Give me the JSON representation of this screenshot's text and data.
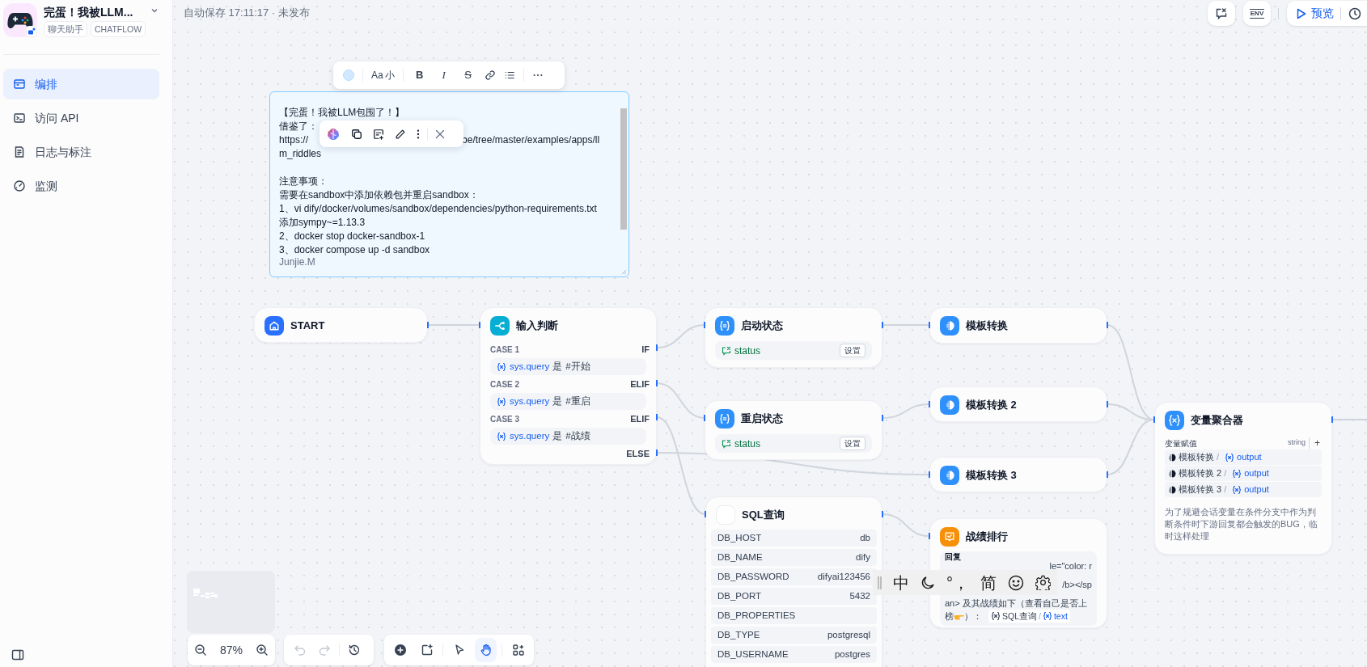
{
  "app": {
    "name": "完蛋！我被LLM...",
    "tags": [
      "聊天助手",
      "CHATFLOW"
    ]
  },
  "nav": [
    {
      "label": "编排",
      "kind": "layout",
      "selected": true
    },
    {
      "label": "访问 API",
      "kind": "terminal",
      "selected": false
    },
    {
      "label": "日志与标注",
      "kind": "log",
      "selected": false
    },
    {
      "label": "监测",
      "kind": "gauge",
      "selected": false
    }
  ],
  "autosave": "自动保存 17:11:17 · 未发布",
  "header": {
    "env": "ENV",
    "preview": "预览"
  },
  "note_toolbar": {
    "font_label": "Aa",
    "font_size": "小",
    "formats": [
      {
        "label": "B",
        "kind": "bold"
      },
      {
        "label": "I",
        "kind": "italic"
      },
      {
        "label": "S",
        "kind": "strike"
      }
    ]
  },
  "note": {
    "paragraphs": [
      [
        [
          "【完蛋！我被LLM包围了！】"
        ],
        [
          "借鉴了："
        ],
        [
          "https://",
          "be/tree/master/examples/apps/ll"
        ],
        [
          "m_riddles"
        ]
      ],
      [
        [
          "注意事项："
        ],
        [
          "需要在sandbox中添加依赖包并重启sandbox："
        ],
        [
          "1、vi dify/docker/volumes/sandbox/dependencies/python-requirements.txt"
        ],
        [
          "添加sympy~=1.13.3"
        ],
        [
          "2、docker stop docker-sandbox-1"
        ],
        [
          "3、docker compose up -d sandbox"
        ]
      ]
    ],
    "author": "Junjie.M"
  },
  "nodes": [
    {
      "kind": "start",
      "title": "START"
    },
    {
      "kind": "if",
      "title": "输入判断",
      "cases": [
        {
          "label": "CASE 1",
          "branch": "IF",
          "variable": "sys.query",
          "operator": "是",
          "value": "#开始"
        },
        {
          "label": "CASE 2",
          "branch": "ELIF",
          "variable": "sys.query",
          "operator": "是",
          "value": "#重启"
        },
        {
          "label": "CASE 3",
          "branch": "ELIF",
          "variable": "sys.query",
          "operator": "是",
          "value": "#战绩"
        }
      ],
      "else": "ELSE"
    },
    {
      "kind": "assigner",
      "title": "启动状态",
      "variable": "status",
      "button": "设置"
    },
    {
      "kind": "assigner",
      "title": "重启状态",
      "variable": "status",
      "button": "设置"
    },
    {
      "kind": "template",
      "title": "模板转换"
    },
    {
      "kind": "template",
      "title": "模板转换 2"
    },
    {
      "kind": "template",
      "title": "模板转换 3"
    },
    {
      "kind": "aggregator",
      "title": "变量聚合器",
      "label": "变量赋值",
      "type": "string",
      "add": "+",
      "items": [
        {
          "node": "模板转换",
          "sep": "/",
          "variable": "output"
        },
        {
          "node": "模板转换 2",
          "sep": "/",
          "variable": "output"
        },
        {
          "node": "模板转换 3",
          "sep": "/",
          "variable": "output"
        }
      ],
      "description": "为了规避会话变量在条件分支中作为判断条件时下游回复都会触发的BUG，临时这样处理"
    },
    {
      "kind": "sql",
      "title": "SQL查询",
      "fields": [
        {
          "key": "DB_HOST",
          "value": "db"
        },
        {
          "key": "DB_NAME",
          "value": "dify"
        },
        {
          "key": "DB_PASSWORD",
          "value": "difyai123456"
        },
        {
          "key": "DB_PORT",
          "value": "5432"
        },
        {
          "key": "DB_PROPERTIES"
        },
        {
          "key": "DB_TYPE",
          "value": "postgresql"
        },
        {
          "key": "DB_USERNAME",
          "value": "postgres"
        }
      ]
    },
    {
      "kind": "answer",
      "title": "战绩排行",
      "label": "回复",
      "line_1": "le=\"color: r",
      "line_2": "/b></sp",
      "line_3": "an> 及其战绩如下（查看自己是否上",
      "line_4_start": "榜",
      "line_4_end": "）：",
      "chip": {
        "node": "SQL查询",
        "sep": "/",
        "variable": "text"
      }
    }
  ],
  "zoom": "87%",
  "tools": [
    {
      "kind": "pointer",
      "selected": false
    },
    {
      "kind": "hand",
      "selected": true
    }
  ],
  "ime": {
    "mode": "中",
    "punctuation": "°，",
    "script": "简"
  }
}
